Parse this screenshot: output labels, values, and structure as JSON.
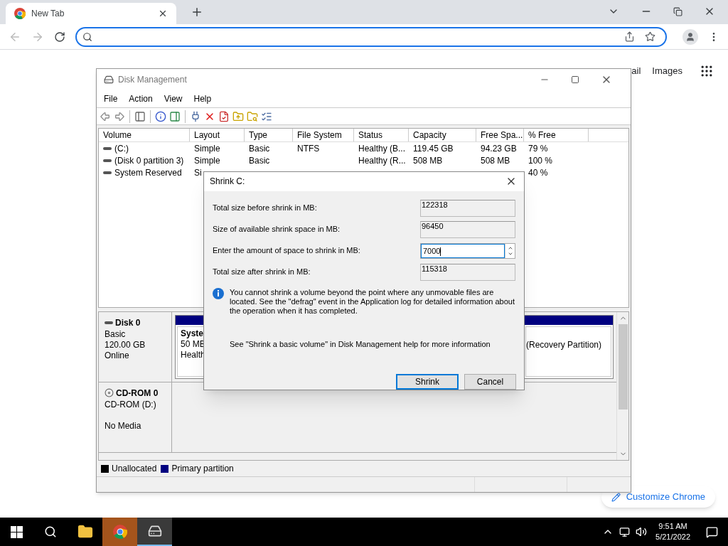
{
  "browser": {
    "tabs": [
      {
        "title": "New Tab",
        "selected": true
      }
    ],
    "links": [
      "ail",
      "Images"
    ],
    "customize": "Customize Chrome"
  },
  "disk_management": {
    "title": "Disk Management",
    "menu": [
      "File",
      "Action",
      "View",
      "Help"
    ],
    "columns": [
      "Volume",
      "Layout",
      "Type",
      "File System",
      "Status",
      "Capacity",
      "Free Spa...",
      "% Free"
    ],
    "rows": [
      {
        "volume": " (C:)",
        "layout": "Simple",
        "type": "Basic",
        "file_system": "NTFS",
        "status": "Healthy (B...",
        "capacity": "119.45 GB",
        "free_space": "94.23 GB",
        "percent_free": "79 %"
      },
      {
        "volume": "(Disk 0 partition 3)",
        "layout": "Simple",
        "type": "Basic",
        "status": "Healthy (R...",
        "capacity": "508 MB",
        "free_space": "508 MB",
        "percent_free": "100 %"
      },
      {
        "volume": "System Reserved",
        "layout": "Si",
        "percent_free": "40 %"
      }
    ],
    "disks": [
      {
        "kind": "disk",
        "name": "Disk 0",
        "lines": [
          "Basic",
          "120.00 GB",
          "Online"
        ],
        "partitions": [
          {
            "lines": [
              "Syste",
              "50 MB",
              "Health"
            ]
          },
          {
            "lines": [
              "(Recovery Partition)"
            ]
          }
        ]
      },
      {
        "kind": "cdrom",
        "name": "CD-ROM 0",
        "lines": [
          "CD-ROM (D:)",
          "No Media"
        ]
      }
    ],
    "legend": [
      {
        "label": "Unallocated",
        "color": "#000000"
      },
      {
        "label": "Primary partition",
        "color": "#000080"
      }
    ]
  },
  "dialog": {
    "title": "Shrink C:",
    "fields": [
      {
        "label": "Total size before shrink in MB:",
        "value": "122318",
        "kind": "readonly"
      },
      {
        "label": "Size of available shrink space in MB:",
        "value": "96450",
        "kind": "readonly"
      },
      {
        "label": "Enter the amount of space to shrink in MB:",
        "value": "7000",
        "kind": "spin"
      },
      {
        "label": "Total size after shrink in MB:",
        "value": "115318",
        "kind": "readonly"
      }
    ],
    "info": "You cannot shrink a volume beyond the point where any unmovable files are located. See the \"defrag\" event in the Application log for detailed information about the operation when it has completed.",
    "help": "See \"Shrink a basic volume\" in Disk Management help for more information",
    "buttons": [
      {
        "label": "Shrink",
        "default": true
      },
      {
        "label": "Cancel",
        "default": false
      }
    ]
  },
  "taskbar": {
    "apps": [
      {
        "kind": "explorer",
        "selected": false,
        "flashing": false
      },
      {
        "kind": "chrome",
        "selected": false,
        "flashing": true
      },
      {
        "kind": "disk",
        "selected": true,
        "flashing": false
      }
    ],
    "time": "9:51 AM",
    "date": "5/21/2022"
  }
}
